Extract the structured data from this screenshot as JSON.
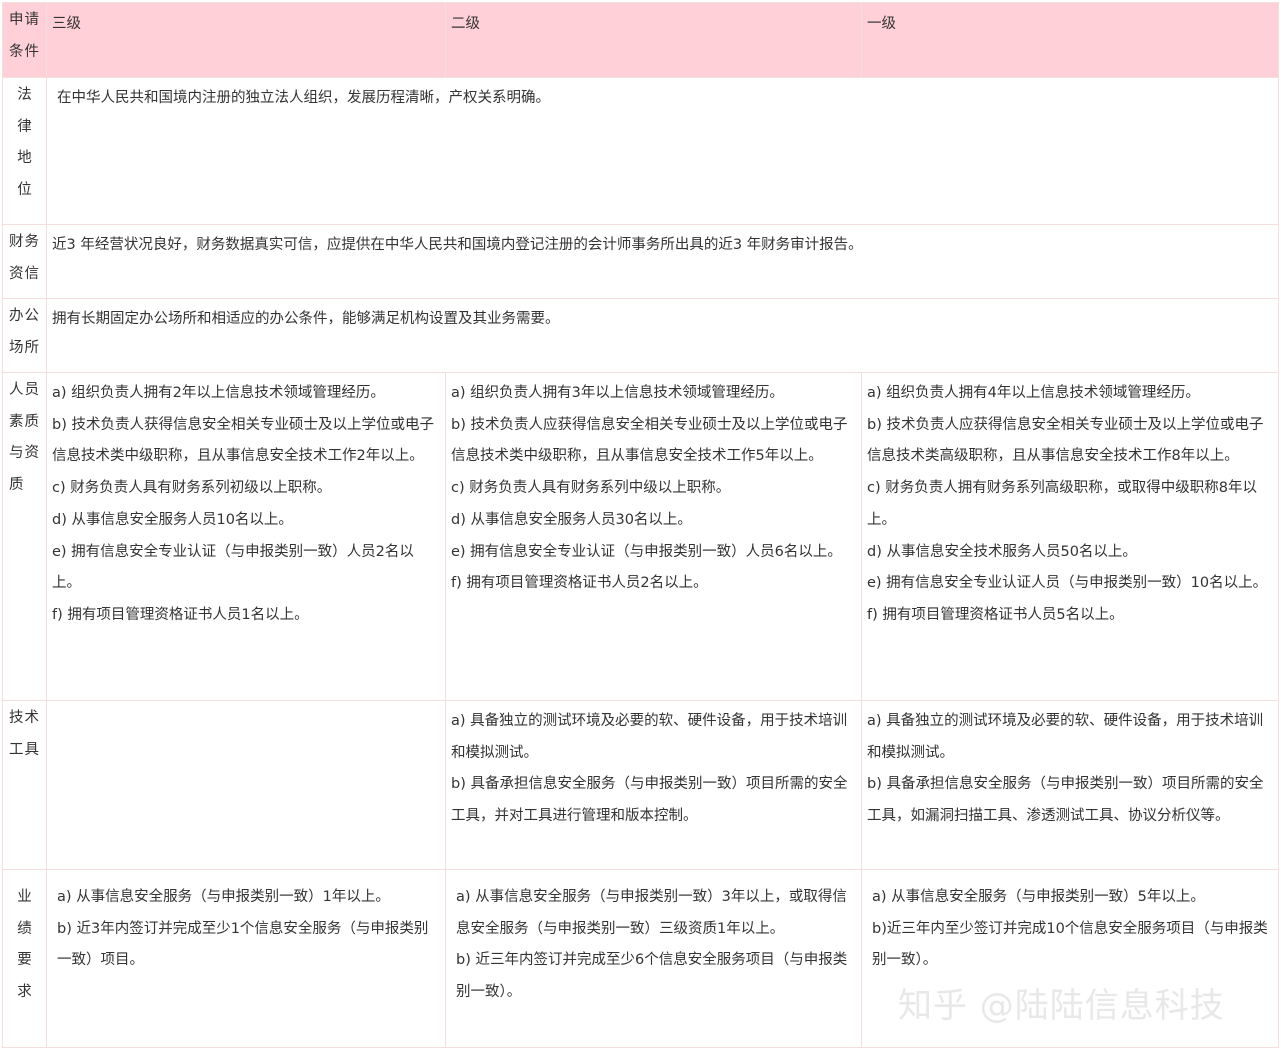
{
  "header": {
    "label": "申请条件",
    "level3": "三级",
    "level2": "二级",
    "level1": "一级"
  },
  "rows": {
    "legal": {
      "label": [
        "法",
        "律",
        "地",
        "位"
      ],
      "text": "在中华人民共和国境内注册的独立法人组织，发展历程清晰，产权关系明确。"
    },
    "finance": {
      "label": "财务资信",
      "text": "近3 年经营状况良好，财务数据真实可信，应提供在中华人民共和国境内登记注册的会计师事务所出具的近3 年财务审计报告。"
    },
    "office": {
      "label": "办公场所",
      "text": "拥有长期固定办公场所和相适应的办公条件，能够满足机构设置及其业务需要。"
    },
    "personnel": {
      "label": "人员素质与资质",
      "level3": [
        "a) 组织负责人拥有2年以上信息技术领域管理经历。",
        "b) 技术负责人获得信息安全相关专业硕士及以上学位或电子信息技术类中级职称，且从事信息安全技术工作2年以上。",
        "c) 财务负责人具有财务系列初级以上职称。",
        "d) 从事信息安全服务人员10名以上。",
        "e) 拥有信息安全专业认证（与申报类别一致）人员2名以上。",
        "f) 拥有项目管理资格证书人员1名以上。"
      ],
      "level2": [
        "a) 组织负责人拥有3年以上信息技术领域管理经历。",
        "b) 技术负责人应获得信息安全相关专业硕士及以上学位或电子信息技术类中级职称，且从事信息安全技术工作5年以上。",
        "c) 财务负责人具有财务系列中级以上职称。",
        "d) 从事信息安全服务人员30名以上。",
        "e) 拥有信息安全专业认证（与申报类别一致）人员6名以上。",
        "f) 拥有项目管理资格证书人员2名以上。"
      ],
      "level1": [
        "a) 组织负责人拥有4年以上信息技术领域管理经历。",
        "b) 技术负责人应获得信息安全相关专业硕士及以上学位或电子信息技术类高级职称，且从事信息安全技术工作8年以上。",
        "c) 财务负责人拥有财务系列高级职称，或取得中级职称8年以上。",
        "d) 从事信息安全技术服务人员50名以上。",
        "e) 拥有信息安全专业认证人员（与申报类别一致）10名以上。",
        "f) 拥有项目管理资格证书人员5名以上。"
      ]
    },
    "tools": {
      "label": "技术工具",
      "level2": [
        "a) 具备独立的测试环境及必要的软、硬件设备，用于技术培训和模拟测试。",
        "b) 具备承担信息安全服务（与申报类别一致）项目所需的安全工具，并对工具进行管理和版本控制。"
      ],
      "level1": [
        "a) 具备独立的测试环境及必要的软、硬件设备，用于技术培训和模拟测试。",
        "b) 具备承担信息安全服务（与申报类别一致）项目所需的安全工具，如漏洞扫描工具、渗透测试工具、协议分析仪等。"
      ]
    },
    "performance": {
      "label": [
        "业",
        "绩",
        "要",
        "求"
      ],
      "level3": [
        "a) 从事信息安全服务（与申报类别一致）1年以上。",
        "b) 近3年内签订并完成至少1个信息安全服务（与申报类别一致）项目。"
      ],
      "level2": [
        "a) 从事信息安全服务（与申报类别一致）3年以上，或取得信息安全服务（与申报类别一致）三级资质1年以上。",
        "b) 近三年内签订并完成至少6个信息安全服务项目（与申报类别一致）。"
      ],
      "level1": [
        "a) 从事信息安全服务（与申报类别一致）5年以上。",
        "b)近三年内至少签订并完成10个信息安全服务项目（与申报类别一致）。"
      ]
    }
  },
  "watermark": "知乎 @陆陆信息科技"
}
